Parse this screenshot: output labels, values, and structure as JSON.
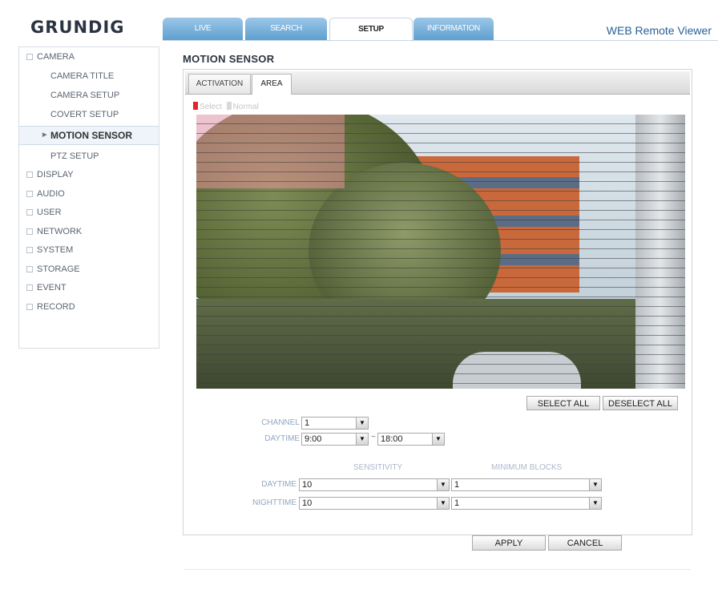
{
  "brand": {
    "logo": "GRUNDIG",
    "app_title": "WEB Remote Viewer"
  },
  "top_tabs": [
    {
      "label": "LIVE"
    },
    {
      "label": "SEARCH"
    },
    {
      "label": "SETUP"
    },
    {
      "label": "INFORMATION"
    }
  ],
  "sidebar": {
    "camera": "CAMERA",
    "camera_items": [
      "CAMERA TITLE",
      "CAMERA SETUP",
      "COVERT SETUP",
      "MOTION SENSOR",
      "PTZ SETUP"
    ],
    "sections": [
      "DISPLAY",
      "AUDIO",
      "USER",
      "NETWORK",
      "SYSTEM",
      "STORAGE",
      "EVENT",
      "RECORD"
    ]
  },
  "page": {
    "title": "MOTION SENSOR",
    "sub_tabs": [
      "ACTIVATION",
      "AREA"
    ],
    "legend": {
      "select": "Select",
      "normal": "Normal"
    }
  },
  "buttons": {
    "select_all": "SELECT ALL",
    "deselect_all": "DESELECT ALL",
    "apply": "APPLY",
    "cancel": "CANCEL"
  },
  "form": {
    "channel_label": "CHANNEL",
    "channel_value": "1",
    "daytime_label": "DAYTIME",
    "daytime_start": "9:00",
    "range_sep": "~",
    "daytime_end": "18:00",
    "sensitivity_header": "SENSITIVITY",
    "min_blocks_header": "MINIMUM BLOCKS",
    "rows": [
      {
        "label": "DAYTIME",
        "sensitivity": "10",
        "min_blocks": "1"
      },
      {
        "label": "NIGHTTIME",
        "sensitivity": "10",
        "min_blocks": "1"
      }
    ]
  },
  "colors": {
    "select": "#e8232a",
    "normal": "#d9d9d9",
    "tab_blue": "#6fa8d6"
  },
  "icons": {
    "dropdown": "chevron-down-icon",
    "bullet": "square-bullet-icon",
    "active": "triangle-right-icon"
  }
}
